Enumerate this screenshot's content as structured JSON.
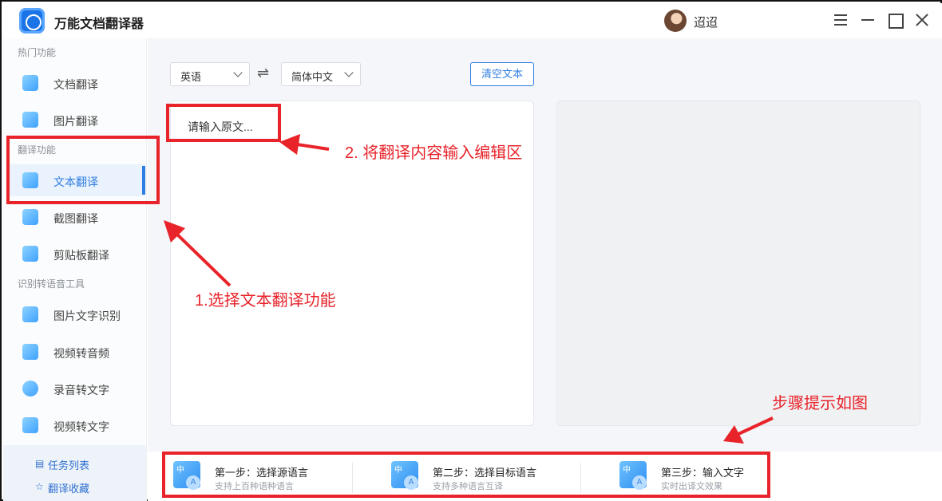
{
  "app": {
    "title": "万能文档翻译器",
    "user": "迢迢"
  },
  "sidebar": {
    "sections": [
      {
        "title": "热门功能"
      },
      {
        "title": "翻译功能"
      },
      {
        "title": "识别转语音工具"
      }
    ],
    "items": [
      {
        "label": "文档翻译",
        "icon": "document-icon"
      },
      {
        "label": "图片翻译",
        "icon": "image-icon"
      },
      {
        "label": "文本翻译",
        "icon": "text-a-icon",
        "active": true
      },
      {
        "label": "截图翻译",
        "icon": "screenshot-icon"
      },
      {
        "label": "剪贴板翻译",
        "icon": "clipboard-icon"
      },
      {
        "label": "图片文字识别",
        "icon": "ocr-icon"
      },
      {
        "label": "视频转音频",
        "icon": "video-audio-icon"
      },
      {
        "label": "录音转文字",
        "icon": "recording-icon"
      },
      {
        "label": "视频转文字",
        "icon": "video-text-icon"
      }
    ],
    "footer": {
      "tasks": "任务列表",
      "favorites": "翻译收藏"
    }
  },
  "toolbar": {
    "source_lang": "英语",
    "target_lang": "简体中文",
    "clear_label": "清空文本"
  },
  "editor": {
    "placeholder": "请输入原文..."
  },
  "steps": [
    {
      "title": "第一步：选择源语言",
      "sub": "支持上百种语种语言"
    },
    {
      "title": "第二步：选择目标语言",
      "sub": "支持多种语言互译"
    },
    {
      "title": "第三步：输入文字",
      "sub": "实时出译文效果"
    }
  ],
  "step_icon": {
    "zh": "中",
    "a": "A"
  },
  "annotations": {
    "step1": "1.选择文本翻译功能",
    "step2": "2. 将翻译内容输入编辑区",
    "hint": "步骤提示如图"
  },
  "colors": {
    "accent": "#2f7de1",
    "annotation": "#e8232a"
  }
}
